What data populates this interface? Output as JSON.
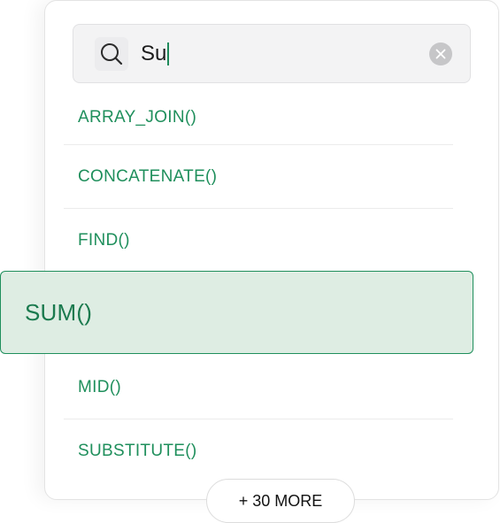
{
  "search": {
    "value": "Su",
    "icon": "search-icon",
    "clear_icon": "close-icon"
  },
  "results": [
    {
      "label": "ARRAY_JOIN()"
    },
    {
      "label": "CONCATENATE()"
    },
    {
      "label": "FIND()"
    },
    {
      "label": "SUM()",
      "highlighted": true
    },
    {
      "label": "MID()"
    },
    {
      "label": "SUBSTITUTE()"
    }
  ],
  "more_button": {
    "label": "+ 30 MORE"
  },
  "colors": {
    "accent": "#1f8f5c",
    "highlight_bg": "#deede3"
  }
}
